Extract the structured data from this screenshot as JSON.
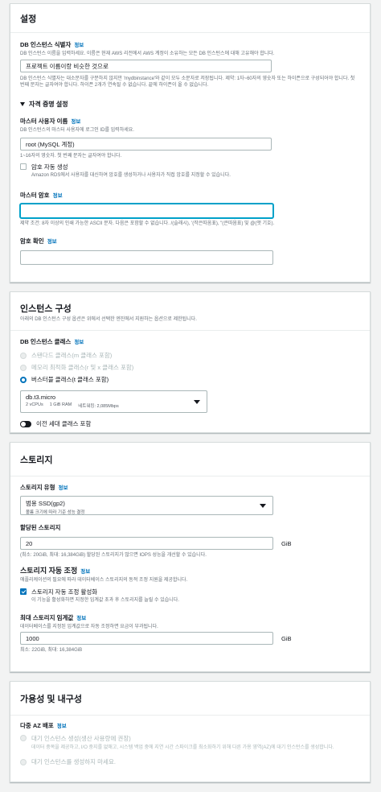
{
  "settings": {
    "title": "설정",
    "db_id": {
      "label": "DB 인스턴스 식별자",
      "info": "정보",
      "desc": "DB 인스턴스 이름을 입력하세요. 이름은 현재 AWS 리전에서 AWS 계정이 소유하는 모든 DB 인스턴스에 대해 고유해야 합니다.",
      "value": "프로젝트 이름이랑 비슷한 것으로",
      "constraint": "DB 인스턴스 식별자는 대소문자를 구분하지 않지만 'mydbinstance'와 같이 모두 소문자로 저장됩니다. 제약: 1자~60자의 영숫자 또는 하이픈으로 구성되어야 합니다. 첫 번째 문자는 글자여야 합니다. 하이픈 2개가 연속될 수 없습니다. 끝에 하이픈이 올 수 없습니다."
    },
    "credentials": {
      "header": "자격 증명 설정",
      "master_user_label": "마스터 사용자 이름",
      "info": "정보",
      "master_user_desc": "DB 인스턴스의 마스터 사용자에 로그인 ID를 입력하세요.",
      "master_user_value": "root (MySQL 계정)",
      "master_user_constraint": "1~16자의 영숫자. 첫 번째 문자는 글자여야 합니다.",
      "auto_pw_label": "암호 자동 생성",
      "auto_pw_desc": "Amazon RDS에서 사용자를 대신하여 암호를 생성하거나 사용자가 직접 암호를 지정할 수 있습니다.",
      "master_pw_label": "마스터 암호",
      "master_pw_constraint": "제약 조건: 8자 이상의 인쇄 가능한 ASCII 문자. 다음은 포함할 수 없습니다. /(슬래시), '(작은따옴표), \"(큰따옴표) 및 @(앳 기호).",
      "confirm_pw_label": "암호 확인"
    }
  },
  "instance": {
    "title": "인스턴스 구성",
    "desc": "아래의 DB 인스턴스 구성 옵션은 위에서 선택한 엔진에서 지원하는 옵션으로 제한됩니다.",
    "class_label": "DB 인스턴스 클래스",
    "info": "정보",
    "options": [
      {
        "label": "스탠다드 클래스(m 클래스 포함)"
      },
      {
        "label": "메모리 최적화 클래스(r 및 x 클래스 포함)"
      },
      {
        "label": "버스터블 클래스(t 클래스 포함)"
      }
    ],
    "selected_class": "db.t3.micro",
    "class_vcpu": "2 vCPUs",
    "class_ram": "1 GiB RAM",
    "class_network": "네트워킹: 2,085Mbps",
    "prev_gen_label": "이전 세대 클래스 포함"
  },
  "storage": {
    "title": "스토리지",
    "type_label": "스토리지 유형",
    "info": "정보",
    "type_value": "범용 SSD(gp2)",
    "type_sub": "볼륨 크기에 따라 기준 성능 결정",
    "alloc_label": "할당된 스토리지",
    "alloc_value": "20",
    "alloc_unit": "GiB",
    "alloc_desc": "(최소: 20GiB, 최대: 16,384GiB) 할당된 스토리지가 많으면 IOPS 성능을 개선할 수 있습니다.",
    "autoscale_title": "스토리지 자동 조정",
    "autoscale_info": "정보",
    "autoscale_desc": "애플리케이션의 필요에 따라 데이터베이스 스토리지의 동적 조정 지원을 제공합니다.",
    "autoscale_check_label": "스토리지 자동 조정 활성화",
    "autoscale_check_desc": "이 기능을 활성화하면 지정한 임계값 초과 후 스토리지를 늘릴 수 있습니다.",
    "max_label": "최대 스토리지 임계값",
    "max_info": "정보",
    "max_desc": "데이터베이스를 지정된 임계값으로 자동 조정하면 요금이 부과됩니다.",
    "max_value": "1000",
    "max_unit": "GiB",
    "max_constraint": "최소: 22GiB, 최대: 16,384GiB"
  },
  "availability": {
    "title": "가용성 및 내구성",
    "multi_az_label": "다중 AZ 배포",
    "info": "정보",
    "opt1_label": "대기 인스턴스 생성(생산 사용량에 권장)",
    "opt1_desc": "데이터 중복을 제공하고, I/O 중지를 없애고, 시스템 백업 중에 지연 시간 스파이크를 최소화하기 위해 다른 가용 영역(AZ)에 대기 인스턴스를 생성합니다.",
    "opt2_label": "대기 인스턴스를 생성하지 마세요."
  }
}
